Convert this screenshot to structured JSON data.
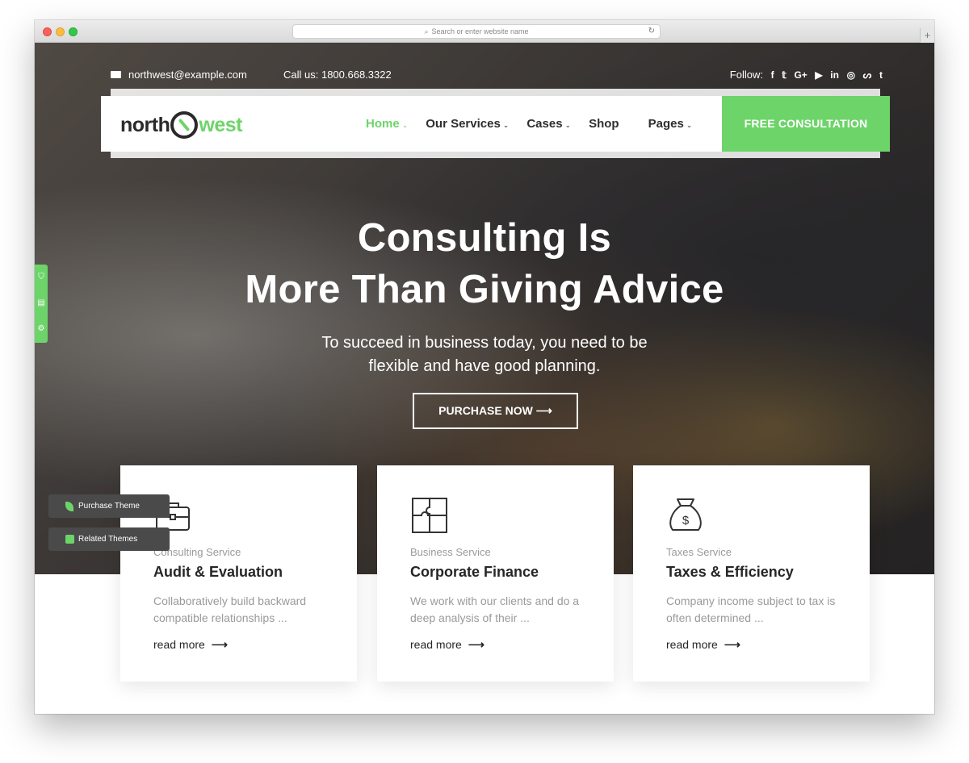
{
  "browser": {
    "address_placeholder": "Search or enter website name"
  },
  "topbar": {
    "email": "northwest@example.com",
    "phone": "Call us:  1800.668.3322",
    "follow_label": "Follow:",
    "social": [
      "f",
      "t",
      "G+",
      "yt",
      "in",
      "ig",
      "su",
      "t"
    ]
  },
  "logo": {
    "part1": "north",
    "part2": "west"
  },
  "nav": {
    "items": [
      {
        "label": "Home",
        "dropdown": true,
        "active": true
      },
      {
        "label": "Our Services",
        "dropdown": true,
        "active": false
      },
      {
        "label": "Cases",
        "dropdown": true,
        "active": false
      },
      {
        "label": "Shop",
        "dropdown": false,
        "active": false
      },
      {
        "label": "Pages",
        "dropdown": true,
        "active": false
      }
    ],
    "cta": "FREE CONSULTATION"
  },
  "hero": {
    "title_line1": "Consulting Is",
    "title_line2": "More Than Giving Advice",
    "subtitle_line1": "To succeed in business today, you need to be",
    "subtitle_line2": "flexible and have good planning.",
    "button": "PURCHASE NOW ⟶"
  },
  "floating": {
    "purchase": "Purchase Theme",
    "related": "Related Themes"
  },
  "services": [
    {
      "icon": "briefcase-icon",
      "category": "Consulting Service",
      "title": "Audit & Evaluation",
      "desc": "Collaboratively build backward compatible relationships ...",
      "more": "read more"
    },
    {
      "icon": "puzzle-icon",
      "category": "Business Service",
      "title": "Corporate Finance",
      "desc": "We work with our clients and do a deep analysis of their ...",
      "more": "read more"
    },
    {
      "icon": "money-bag-icon",
      "category": "Taxes Service",
      "title": "Taxes & Efficiency",
      "desc": "Company income subject to tax is often determined ...",
      "more": "read more"
    }
  ],
  "colors": {
    "accent": "#6dd46a",
    "dark_text": "#262626"
  }
}
